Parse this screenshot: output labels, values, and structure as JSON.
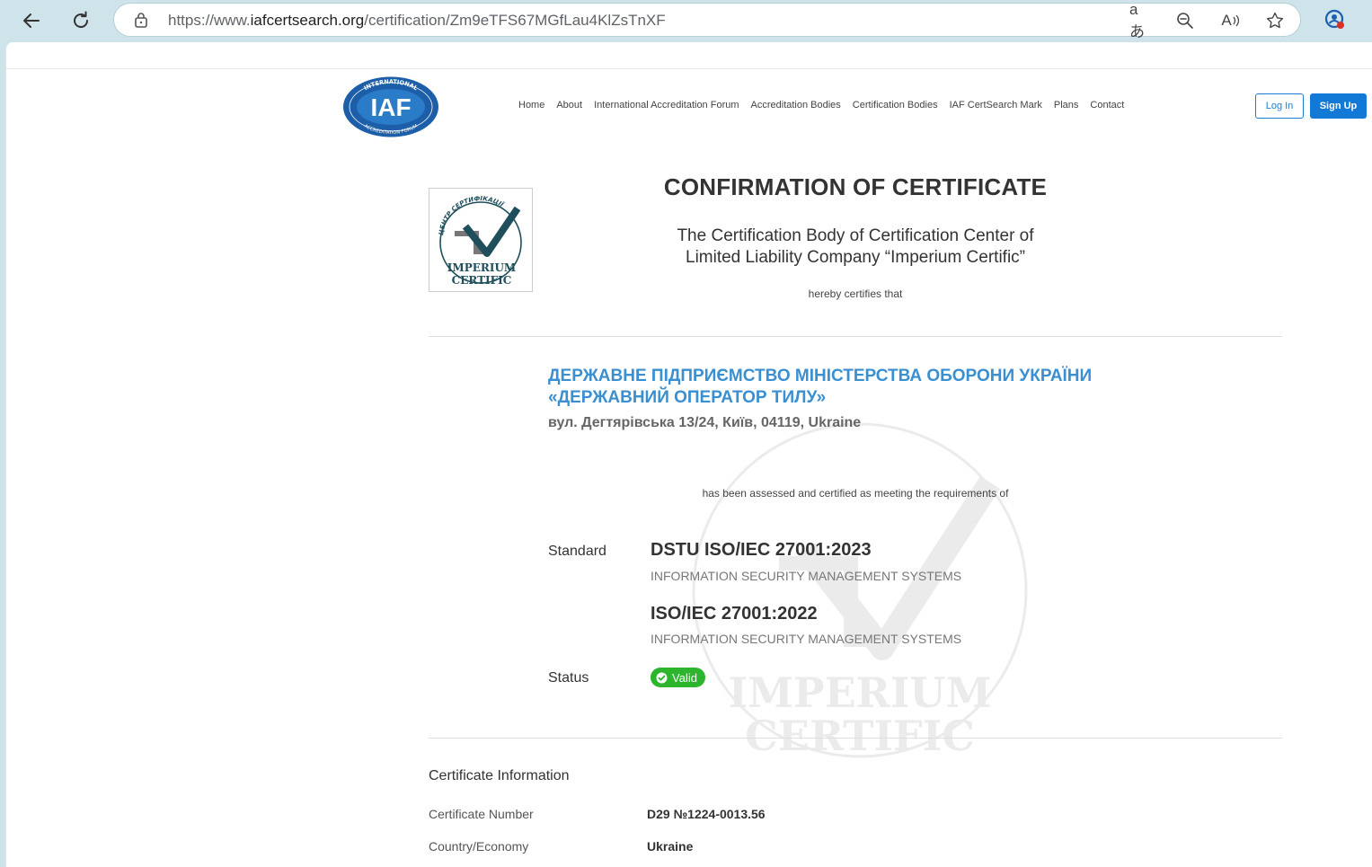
{
  "browser": {
    "url_prefix": "https://www.",
    "url_domain": "iafcertsearch.org",
    "url_path": "/certification/Zm9eTFS67MGfLau4KlZsTnXF",
    "translate_glyph": "aあ",
    "read_aloud_glyph": "A"
  },
  "nav": {
    "items": [
      "Home",
      "About",
      "International Accreditation Forum",
      "Accreditation Bodies",
      "Certification Bodies",
      "IAF CertSearch Mark",
      "Plans",
      "Contact"
    ],
    "login": "Log In",
    "signup": "Sign Up"
  },
  "logo": {
    "iaf_text": "IAF",
    "iaf_ring_top": "INTERNATIONAL",
    "iaf_ring_bottom": "ACCREDITATION FORUM"
  },
  "certificate": {
    "title": "CONFIRMATION OF CERTIFICATE",
    "cb_name_line1": "The Certification Body of Certification Center of",
    "cb_name_line2": "Limited Liability Company “Imperium Certific”",
    "hereby": "hereby certifies that",
    "org_line1": "ДЕРЖАВНЕ ПІДПРИЄМСТВО МІНІСТЕРСТВА ОБОРОНИ УКРАЇНИ",
    "org_line2": "«ДЕРЖАВНИЙ ОПЕРАТОР ТИЛУ»",
    "org_address": "вул. Дегтярівська 13/24, Київ, 04119, Ukraine",
    "assessed": "has been assessed and certified as meeting the requirements of",
    "standard_label": "Standard",
    "standards": [
      {
        "code": "DSTU ISO/IEC 27001:2023",
        "desc": "INFORMATION SECURITY MANAGEMENT SYSTEMS"
      },
      {
        "code": "ISO/IEC 27001:2022",
        "desc": "INFORMATION SECURITY MANAGEMENT SYSTEMS"
      }
    ],
    "status_label": "Status",
    "status_value": "Valid",
    "status_color": "#2db52d"
  },
  "cb_logo": {
    "ring_text": "ЦЕНТР СЕРТИФІКАЦІЇ",
    "line1": "IMPERIUM",
    "line2": "CERTIFIC"
  },
  "info": {
    "heading": "Certificate Information",
    "rows": [
      {
        "label": "Certificate Number",
        "value": "D29 №1224-0013.56"
      },
      {
        "label": "Country/Economy",
        "value": "Ukraine"
      }
    ]
  },
  "colors": {
    "accent": "#1279d6",
    "org_blue": "#3a8fd1",
    "chrome_bg": "#cfe3ea"
  }
}
